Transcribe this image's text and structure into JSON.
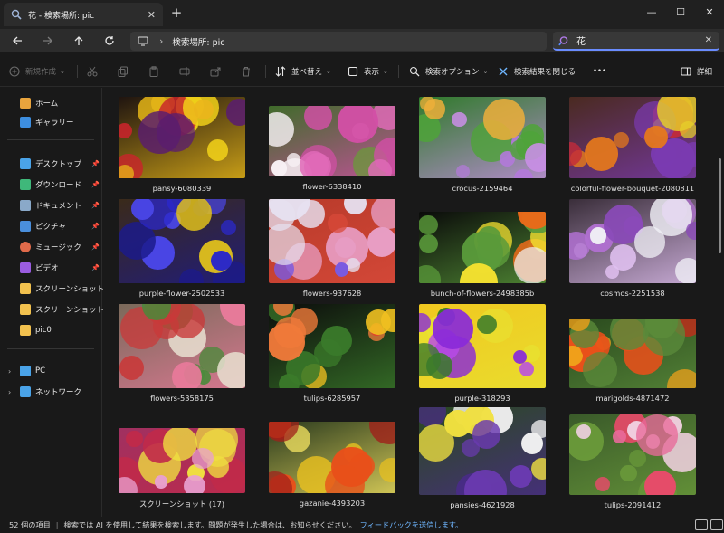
{
  "tab": {
    "title": "花 - 検索場所: pic",
    "icon": "search-icon"
  },
  "window": {
    "minimize": "—",
    "maximize": "☐",
    "close": "✕"
  },
  "address": {
    "path": "検索場所: pic",
    "search_value": "花"
  },
  "toolbar": {
    "new": "新規作成",
    "sort": "並べ替え",
    "view": "表示",
    "search_options": "検索オプション",
    "close_search": "検索結果を閉じる",
    "more": "•••",
    "details": "詳細"
  },
  "sidebar": {
    "items": [
      {
        "label": "ホーム",
        "icon": "home-icon",
        "color": "#e9a43d"
      },
      {
        "label": "ギャラリー",
        "icon": "gallery-icon",
        "color": "#3d8ee0"
      },
      {
        "label": "デスクトップ",
        "icon": "desktop-icon",
        "color": "#4aa3e8",
        "pinned": true
      },
      {
        "label": "ダウンロード",
        "icon": "download-icon",
        "color": "#3fb87a",
        "pinned": true
      },
      {
        "label": "ドキュメント",
        "icon": "document-icon",
        "color": "#8aa9c9",
        "pinned": true
      },
      {
        "label": "ピクチャ",
        "icon": "pictures-icon",
        "color": "#4a8fdc",
        "pinned": true
      },
      {
        "label": "ミュージック",
        "icon": "music-icon",
        "color": "#e06a4a",
        "pinned": true
      },
      {
        "label": "ビデオ",
        "icon": "video-icon",
        "color": "#9a5ce0",
        "pinned": true
      },
      {
        "label": "スクリーンショット",
        "icon": "folder-icon",
        "color": "#f2c14e"
      },
      {
        "label": "スクリーンショット",
        "icon": "folder-icon",
        "color": "#f2c14e"
      },
      {
        "label": "pic0",
        "icon": "folder-icon",
        "color": "#f2c14e"
      },
      {
        "label": "PC",
        "icon": "pc-icon",
        "color": "#4aa3e8"
      },
      {
        "label": "ネットワーク",
        "icon": "network-icon",
        "color": "#4aa3e8"
      }
    ]
  },
  "files": [
    {
      "name": "pansy-6080339",
      "palette": [
        "#1f1410",
        "#f2d219",
        "#5a1d6e",
        "#c8242b",
        "#e8b818"
      ]
    },
    {
      "name": "flower-6338410",
      "palette": [
        "#3f6b2a",
        "#e06ab8",
        "#f7f0f4",
        "#6a9a3a",
        "#d24fa6"
      ]
    },
    {
      "name": "crocus-2159464",
      "palette": [
        "#2f7a2a",
        "#b27ad8",
        "#f0b03a",
        "#4fa33a",
        "#c98fe6"
      ]
    },
    {
      "name": "colorful-flower-bouquet-2080811",
      "palette": [
        "#4a2a20",
        "#e6d02a",
        "#c22a3a",
        "#e87a1a",
        "#7a3ab0"
      ]
    },
    {
      "name": "purple-flower-2502533",
      "palette": [
        "#3a2a1a",
        "#2b28c8",
        "#4a46e6",
        "#e6c61a",
        "#1c1a8a"
      ]
    },
    {
      "name": "flowers-937628",
      "palette": [
        "#b83a2a",
        "#e6e0f0",
        "#7a5ae0",
        "#e8a0c8",
        "#d84a3a"
      ]
    },
    {
      "name": "bunch-of-flowers-2498385b",
      "palette": [
        "#0a0a0a",
        "#e86a1a",
        "#f2e030",
        "#f0f0f0",
        "#5a9a3a"
      ]
    },
    {
      "name": "cosmos-2251538",
      "palette": [
        "#3a2e3a",
        "#b070d0",
        "#f0f0f6",
        "#8a4ab8",
        "#e0c0f0"
      ]
    },
    {
      "name": "flowers-5358175",
      "palette": [
        "#7a6a5a",
        "#c83a3a",
        "#e8e0d0",
        "#4a8a3a",
        "#e87a9a"
      ]
    },
    {
      "name": "tulips-6285957",
      "palette": [
        "#0c0c0c",
        "#e83a2a",
        "#f0c020",
        "#f07a3a",
        "#3a7a2a"
      ]
    },
    {
      "name": "purple-318293",
      "palette": [
        "#f0c820",
        "#8a2ad8",
        "#b84ae8",
        "#3a7a2a",
        "#e8e030"
      ]
    },
    {
      "name": "marigolds-4871472",
      "palette": [
        "#2a4a1e",
        "#e8501a",
        "#f0a01a",
        "#c82a1a",
        "#5a8a3a"
      ]
    },
    {
      "name": "スクリーンショット (17)",
      "palette": [
        "#a03060",
        "#e84a8a",
        "#f0e040",
        "#e8a0d0",
        "#c02a4a"
      ]
    },
    {
      "name": "gazanie-4393203",
      "palette": [
        "#2a3a1e",
        "#e8c020",
        "#e8501a",
        "#a0201a",
        "#f0e060"
      ]
    },
    {
      "name": "pansies-4621928",
      "palette": [
        "#2a4a1e",
        "#6a3ab0",
        "#f0e040",
        "#f0f0f0",
        "#4a2a8a"
      ]
    },
    {
      "name": "tulips-2091412",
      "palette": [
        "#3a5a2a",
        "#e86a9a",
        "#f0d0e0",
        "#e84a6a",
        "#6a9a3a"
      ]
    }
  ],
  "status": {
    "count": "52 個の項目",
    "message": "検索では AI を使用して結果を検索します。問題が発生した場合は、お知らせください。",
    "feedback": "フィードバックを送信します。"
  }
}
